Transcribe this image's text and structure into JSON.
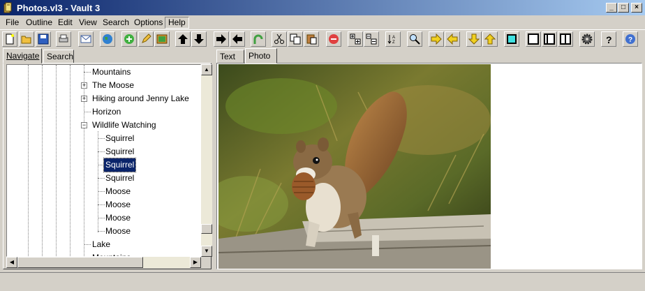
{
  "window": {
    "title": "Photos.vl3 - Vault 3"
  },
  "title_buttons": {
    "minimize": "_",
    "maximize": "□",
    "close": "×"
  },
  "menu": [
    {
      "label": "File"
    },
    {
      "label": "Outline"
    },
    {
      "label": "Edit"
    },
    {
      "label": "View"
    },
    {
      "label": "Search"
    },
    {
      "label": "Options"
    },
    {
      "label": "Help"
    }
  ],
  "toolbar": {
    "icons": [
      "new-file-icon",
      "open-folder-icon",
      "save-icon",
      "print-icon",
      "email-icon",
      "globe-icon",
      "add-icon",
      "edit-icon",
      "insert-image-icon",
      "arrow-up-icon",
      "arrow-down-icon",
      "arrow-right-icon",
      "arrow-left-icon",
      "redo-icon",
      "cut-icon",
      "copy-icon",
      "paste-icon",
      "delete-icon",
      "expand-all-icon",
      "collapse-all-icon",
      "sort-icon",
      "find-icon",
      "yellow-right-icon",
      "yellow-left-icon",
      "yellow-down-icon",
      "yellow-up-icon",
      "color-icon",
      "layout-single-icon",
      "layout-left-icon",
      "layout-split-icon",
      "settings-icon",
      "help-icon",
      "info-icon"
    ]
  },
  "left_tabs": [
    {
      "label": "Navigate",
      "selected": true
    },
    {
      "label": "Search",
      "selected": false
    }
  ],
  "right_tabs": [
    {
      "label": "Text",
      "selected": false
    },
    {
      "label": "Photo",
      "selected": true
    }
  ],
  "tree": {
    "nodes": [
      {
        "label": "Mountains",
        "level": 1
      },
      {
        "label": "The Moose",
        "level": 1,
        "expander": "+"
      },
      {
        "label": "Hiking around Jenny Lake",
        "level": 1,
        "expander": "+"
      },
      {
        "label": "Horizon",
        "level": 1
      },
      {
        "label": "Wildlife Watching",
        "level": 1,
        "expander": "−"
      },
      {
        "label": "Squirrel",
        "level": 2
      },
      {
        "label": "Squirrel",
        "level": 2
      },
      {
        "label": "Squirrel",
        "level": 2,
        "selected": true
      },
      {
        "label": "Squirrel",
        "level": 2
      },
      {
        "label": "Moose",
        "level": 2
      },
      {
        "label": "Moose",
        "level": 2
      },
      {
        "label": "Moose",
        "level": 2
      },
      {
        "label": "Moose",
        "level": 2
      },
      {
        "label": "Lake",
        "level": 1
      },
      {
        "label": "Mountains",
        "level": 1
      }
    ]
  },
  "scroll_arrows": {
    "up": "▲",
    "down": "▼",
    "left": "◀",
    "right": "▶"
  },
  "colors": {
    "title_start": "#0a246a",
    "title_end": "#a6caf0",
    "selection": "#0a246a",
    "face": "#d4d0c8"
  }
}
